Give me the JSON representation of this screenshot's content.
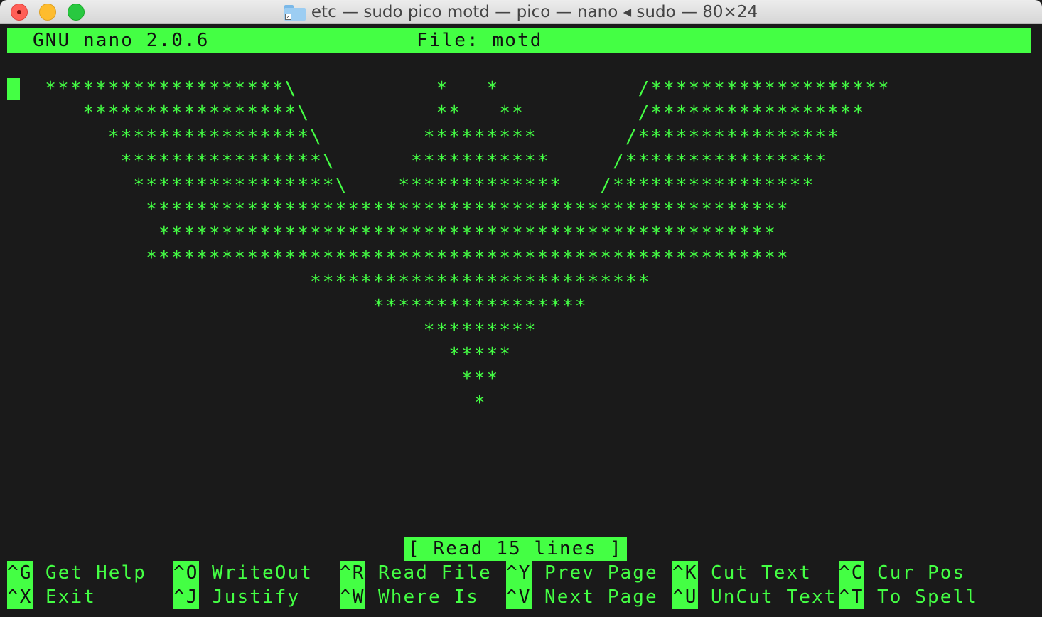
{
  "window": {
    "title": "etc — sudo pico motd — pico — nano ◂ sudo — 80×24"
  },
  "nano": {
    "version": "GNU nano 2.0.6",
    "file": "File: motd"
  },
  "art_lines": [
    "   *******************\\           *   *           /*******************",
    "      *****************\\          **   **         /*****************",
    "        ****************\\        *********       /****************",
    "         ****************\\      ***********     /****************",
    "          ****************\\    *************   /****************",
    "           ***************************************************",
    "            *************************************************",
    "           ***************************************************",
    "                        ***************************",
    "                             *****************",
    "                                 *********",
    "                                   *****",
    "                                    ***",
    "                                     *"
  ],
  "status": "[ Read 15 lines ]",
  "shortcuts": [
    {
      "key": "^G",
      "label": "Get Help"
    },
    {
      "key": "^O",
      "label": "WriteOut"
    },
    {
      "key": "^R",
      "label": "Read File"
    },
    {
      "key": "^Y",
      "label": "Prev Page"
    },
    {
      "key": "^K",
      "label": "Cut Text"
    },
    {
      "key": "^C",
      "label": "Cur Pos"
    },
    {
      "key": "^X",
      "label": "Exit"
    },
    {
      "key": "^J",
      "label": "Justify"
    },
    {
      "key": "^W",
      "label": "Where Is"
    },
    {
      "key": "^V",
      "label": "Next Page"
    },
    {
      "key": "^U",
      "label": "UnCut Text"
    },
    {
      "key": "^T",
      "label": "To Spell"
    }
  ]
}
